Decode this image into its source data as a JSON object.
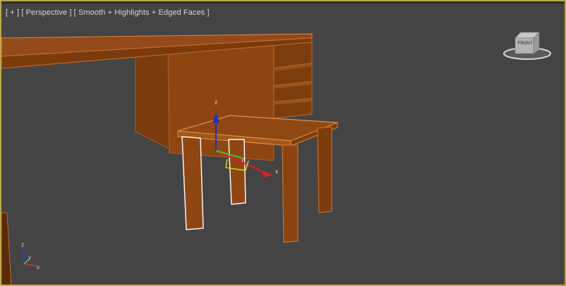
{
  "viewport": {
    "menu_plus": "[ + ]",
    "view_name": "[ Perspective ]",
    "shading_mode": "[ Smooth + Highlights + Edged Faces ]"
  },
  "viewcube": {
    "face_label": "FRONT"
  },
  "gizmo": {
    "x_label": "x",
    "y_label": "y",
    "z_label": "z"
  },
  "tripod": {
    "x_label": "x",
    "y_label": "y",
    "z_label": "z"
  },
  "colors": {
    "viewport_bg": "#444444",
    "active_border": "#bfa64a",
    "wood_main": "#8a4510",
    "wood_dark": "#6b3208",
    "wood_light": "#a95e1f",
    "edge": "#e08a3a",
    "selected_edge": "#ffffff",
    "axis_x": "#e02020",
    "axis_y": "#40c040",
    "axis_z": "#2030c0",
    "gizmo_plane": "#e0d020"
  }
}
